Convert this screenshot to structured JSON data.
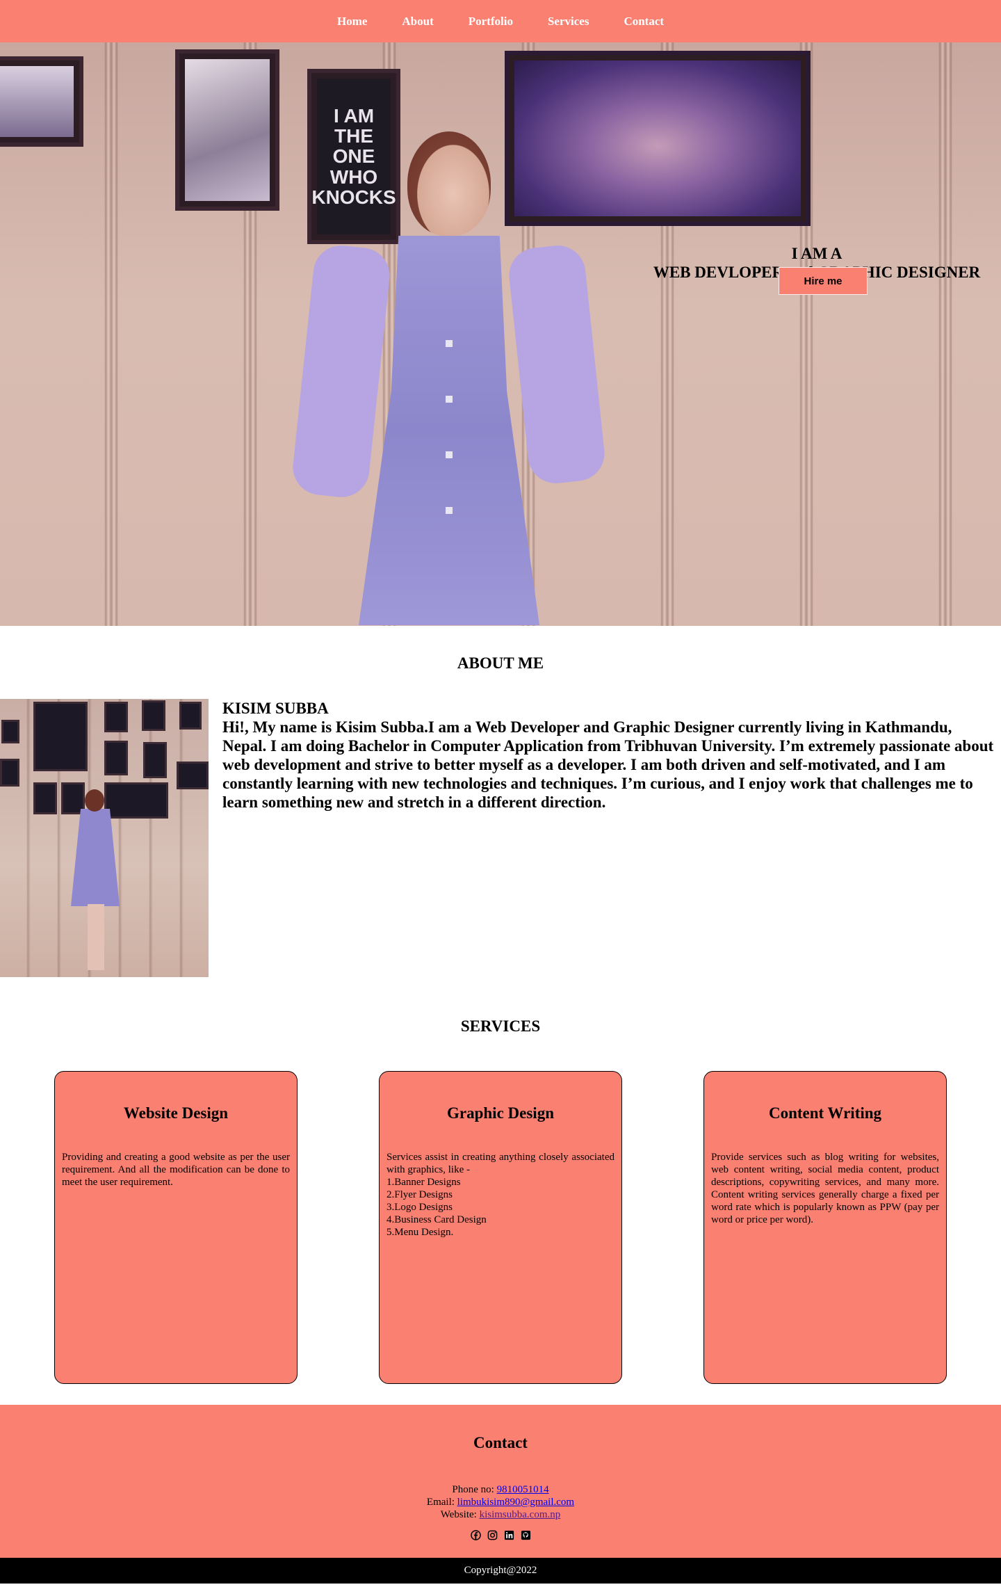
{
  "nav": {
    "items": [
      {
        "label": "Home"
      },
      {
        "label": "About"
      },
      {
        "label": "Portfolio"
      },
      {
        "label": "Services"
      },
      {
        "label": "Contact"
      }
    ]
  },
  "hero": {
    "line1": "I AM A",
    "line2": "WEB DEVLOPER and GRAPHIC DESIGNER",
    "poster_text": "I AM THE ONE WHO KNOCKS",
    "hire_label": "Hire me"
  },
  "about": {
    "title": "ABOUT ME",
    "name": "KISIM SUBBA",
    "body": "Hi!, My name is Kisim Subba.I am a Web Developer and Graphic Designer currently living in Kathmandu, Nepal. I am doing Bachelor in Computer Application from Tribhuvan University. I’m extremely passionate about web development and strive to better myself as a developer. I am both driven and self-motivated, and I am constantly learning with new technologies and techniques. I’m curious, and I enjoy work that challenges me to learn something new and stretch in a different direction."
  },
  "services": {
    "title": "SERVICES",
    "cards": [
      {
        "title": "Website Design",
        "text": "Providing and creating a good website as per the user requirement. And all the modification can be done to meet the user requirement."
      },
      {
        "title": "Graphic Design",
        "text": "Services assist in creating anything closely associated with graphics, like -\n1.Banner Designs\n2.Flyer Designs\n3.Logo Designs\n4.Business Card Design\n5.Menu Design."
      },
      {
        "title": "Content Writing",
        "text": "Provide services such as blog writing for websites, web content writing, social media content, product descriptions, copywriting services, and many more. Content writing services generally charge a fixed per word rate which is popularly known as PPW (pay per word or price per word)."
      }
    ]
  },
  "contact": {
    "title": "Contact",
    "phone_label": "Phone no: ",
    "phone": "9810051014",
    "email_label": "Email: ",
    "email": "limbukisim890@gmail.com",
    "website_label": "Website: ",
    "website": "kisimsubba.com.np",
    "socials": [
      "facebook-icon",
      "instagram-icon",
      "linkedin-icon",
      "github-icon"
    ]
  },
  "footer": {
    "copyright": "Copyright@2022"
  },
  "colors": {
    "accent": "#fa8072",
    "footer_bg": "#000000",
    "link": "#0000ee",
    "visited_link": "#551a8b"
  }
}
